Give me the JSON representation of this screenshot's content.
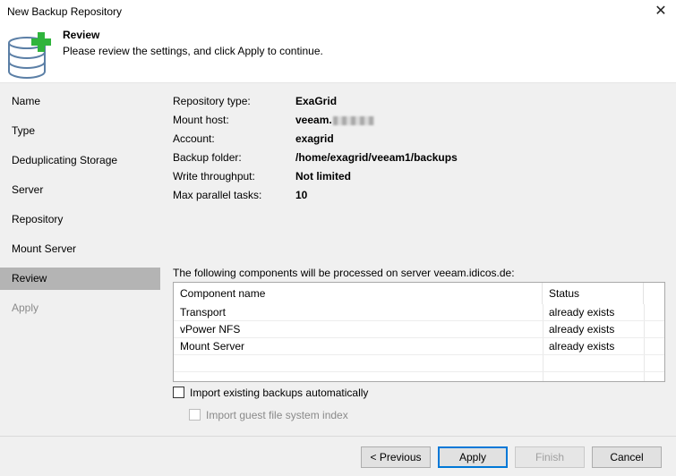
{
  "window": {
    "title": "New Backup Repository"
  },
  "header": {
    "title": "Review",
    "subtitle": "Please review the settings, and click Apply to continue."
  },
  "sidebar": {
    "items": [
      {
        "label": "Name",
        "state": "normal"
      },
      {
        "label": "Type",
        "state": "normal"
      },
      {
        "label": "Deduplicating Storage",
        "state": "normal"
      },
      {
        "label": "Server",
        "state": "normal"
      },
      {
        "label": "Repository",
        "state": "normal"
      },
      {
        "label": "Mount Server",
        "state": "normal"
      },
      {
        "label": "Review",
        "state": "active"
      },
      {
        "label": "Apply",
        "state": "disabled"
      }
    ]
  },
  "summary": [
    {
      "key": "Repository type:",
      "value": "ExaGrid"
    },
    {
      "key": "Mount host:",
      "value": "veeam."
    },
    {
      "key": "Account:",
      "value": "exagrid"
    },
    {
      "key": "Backup folder:",
      "value": "/home/exagrid/veeam1/backups"
    },
    {
      "key": "Write throughput:",
      "value": "Not limited"
    },
    {
      "key": "Max parallel tasks:",
      "value": "10"
    }
  ],
  "components": {
    "caption": "The following components will be processed on server veeam.idicos.de:",
    "columns": [
      "Component name",
      "Status"
    ],
    "rows": [
      [
        "Transport",
        "already exists"
      ],
      [
        "vPower NFS",
        "already exists"
      ],
      [
        "Mount Server",
        "already exists"
      ]
    ]
  },
  "options": {
    "import_backups": {
      "label": "Import existing backups automatically",
      "checked": false
    },
    "import_index": {
      "label": "Import guest file system index",
      "checked": false,
      "disabled": true
    }
  },
  "buttons": {
    "previous": "< Previous",
    "apply": "Apply",
    "finish": "Finish",
    "cancel": "Cancel"
  },
  "colors": {
    "accent_focus": "#0078d7",
    "plus_icon": "#2fb43c",
    "db_icon": "#5b7fa6",
    "active_nav": "#b4b4b4"
  }
}
